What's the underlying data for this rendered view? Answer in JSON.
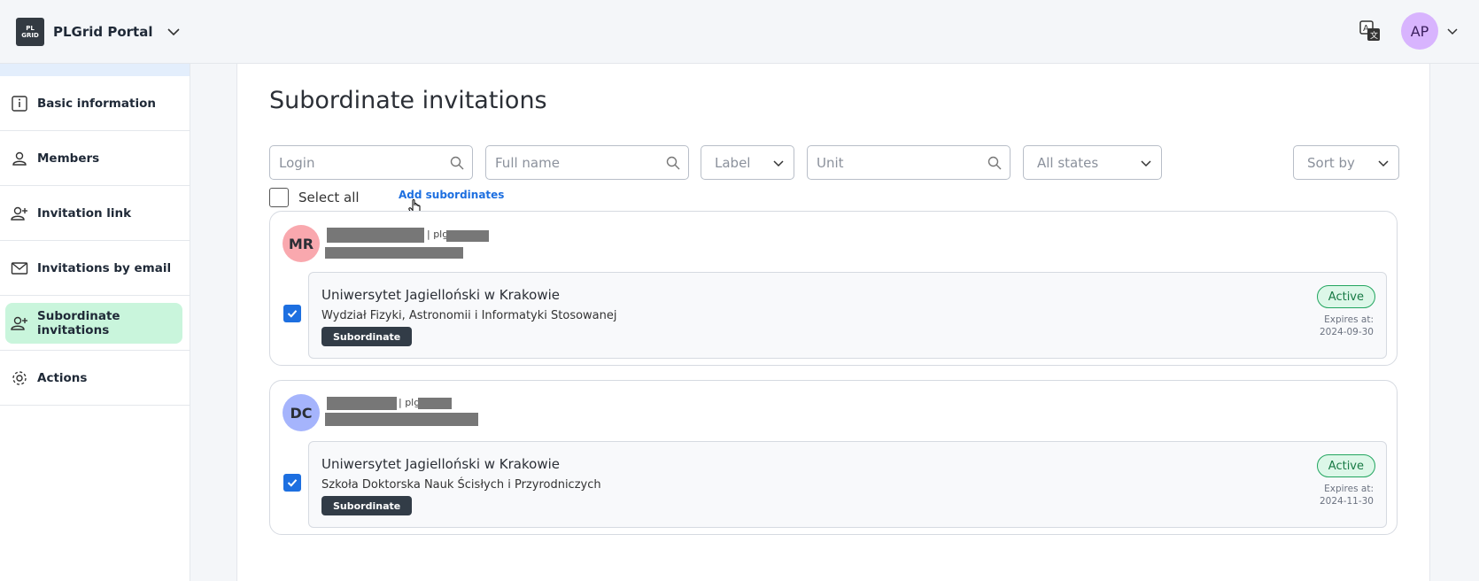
{
  "app": {
    "title": "PLGrid Portal",
    "logo_lines": [
      "PL",
      "GRID"
    ],
    "user_initials": "AP"
  },
  "sidebar": {
    "items": [
      {
        "label": "Basic information",
        "icon": "info-icon"
      },
      {
        "label": "Members",
        "icon": "user-icon"
      },
      {
        "label": "Invitation link",
        "icon": "user-add-icon"
      },
      {
        "label": "Invitations by email",
        "icon": "envelope-icon"
      },
      {
        "label": "Subordinate invitations",
        "icon": "user-add-icon",
        "active": true
      },
      {
        "label": "Actions",
        "icon": "gear-icon"
      }
    ]
  },
  "main": {
    "title": "Subordinate invitations",
    "filters": {
      "login_placeholder": "Login",
      "fullname_placeholder": "Full name",
      "label_select": "Label",
      "unit_placeholder": "Unit",
      "state_select": "All states",
      "sort_select": "Sort by"
    },
    "select_all_label": "Select all",
    "add_subordinates_label": "Add subordinates",
    "invitations": [
      {
        "initials": "MR",
        "avatar_color": "#f9a8ae",
        "login_prefix": "| plg",
        "institution": "Uniwersytet Jagielloński w Krakowie",
        "faculty": "Wydział Fizyki, Astronomii i Informatyki Stosowanej",
        "role": "Subordinate",
        "status": "Active",
        "expires_label": "Expires at:",
        "expires_date": "2024-09-30",
        "checked": true
      },
      {
        "initials": "DC",
        "avatar_color": "#a5b4fc",
        "login_prefix": "| plg",
        "institution": "Uniwersytet Jagielloński w Krakowie",
        "faculty": "Szkoła Doktorska Nauk Ścisłych i Przyrodniczych",
        "role": "Subordinate",
        "status": "Active",
        "expires_label": "Expires at:",
        "expires_date": "2024-11-30",
        "checked": true
      }
    ]
  },
  "colors": {
    "accent": "#1d6fe0",
    "active_nav": "#c9f5dc",
    "status_green": "#22a55f"
  }
}
